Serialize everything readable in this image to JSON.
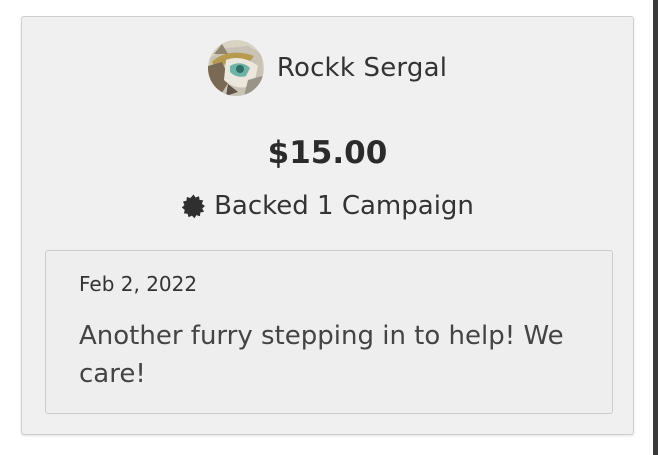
{
  "backer": {
    "name": "Rockk Sergal",
    "avatar_icon": "sergal-avatar-icon"
  },
  "pledge": {
    "amount": "$15.00"
  },
  "stats": {
    "badge_icon": "starburst-badge-icon",
    "backed_label": "Backed 1 Campaign"
  },
  "comment": {
    "date": "Feb 2, 2022",
    "text": "Another furry stepping in to help! We care!"
  },
  "colors": {
    "card_bg": "#f0f0f0",
    "comment_bg": "#eeeeee",
    "text": "#333333"
  }
}
